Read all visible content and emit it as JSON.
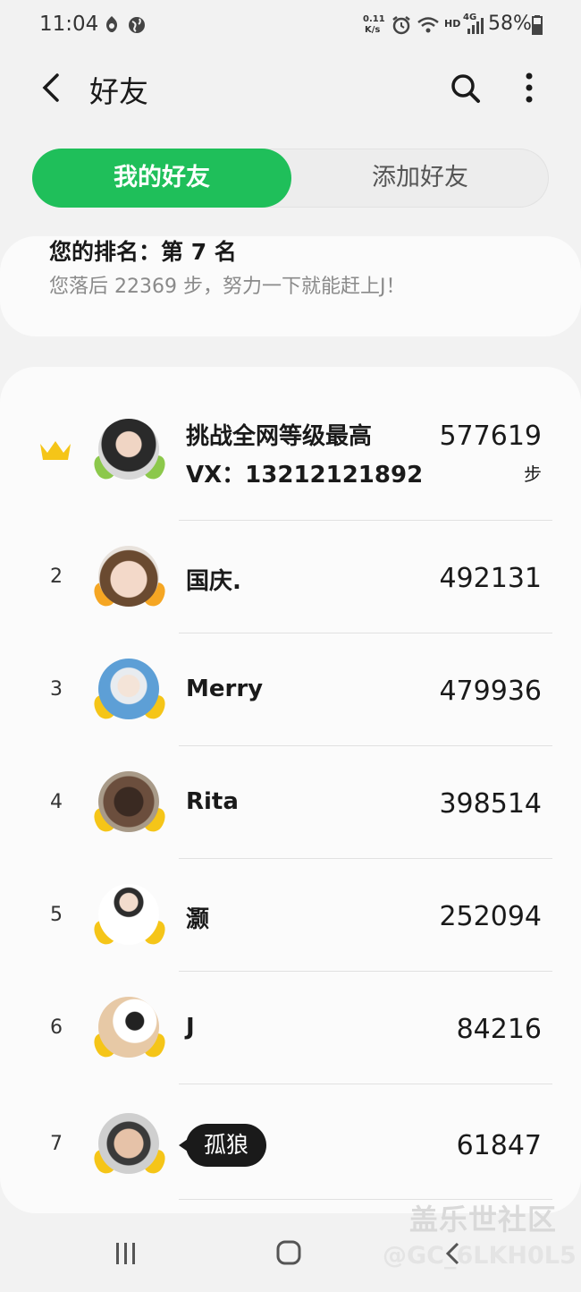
{
  "status_bar": {
    "time": "11:04",
    "speed_value": "0.11",
    "speed_unit": "K/s",
    "hd": "HD",
    "network": "4G",
    "battery": "58%"
  },
  "header": {
    "title": "好友"
  },
  "tabs": [
    {
      "label": "我的好友",
      "active": true
    },
    {
      "label": "添加好友",
      "active": false
    }
  ],
  "my_rank": {
    "title": "您的排名：第 7 名",
    "subtitle": "您落后 22369 步，努力一下就能赶上J！"
  },
  "leaderboard": [
    {
      "rank": "1",
      "crown": true,
      "name": "挑战全网等级最高",
      "name_line2": "VX：13212121892",
      "steps": "577619",
      "unit": "步",
      "wing_color": "#8cc84b"
    },
    {
      "rank": "2",
      "name": "国庆.",
      "steps": "492131",
      "wing_color": "#f5a623"
    },
    {
      "rank": "3",
      "name": "Merry",
      "steps": "479936",
      "wing_color": "#f5c518"
    },
    {
      "rank": "4",
      "name": "Rita",
      "steps": "398514",
      "wing_color": "#f5c518"
    },
    {
      "rank": "5",
      "name": "灏",
      "steps": "252094",
      "wing_color": "#f5c518"
    },
    {
      "rank": "6",
      "name": "J",
      "steps": "84216",
      "wing_color": "#f5c518"
    },
    {
      "rank": "7",
      "name": "孤狼",
      "steps": "61847",
      "wing_color": "#f5c518",
      "highlight": true
    }
  ],
  "watermark": {
    "line1": "盖乐世社区",
    "line2": "@GC_6LKH0L5"
  },
  "colors": {
    "accent_green": "#1fbf5a",
    "crown_gold": "#f5c518"
  }
}
